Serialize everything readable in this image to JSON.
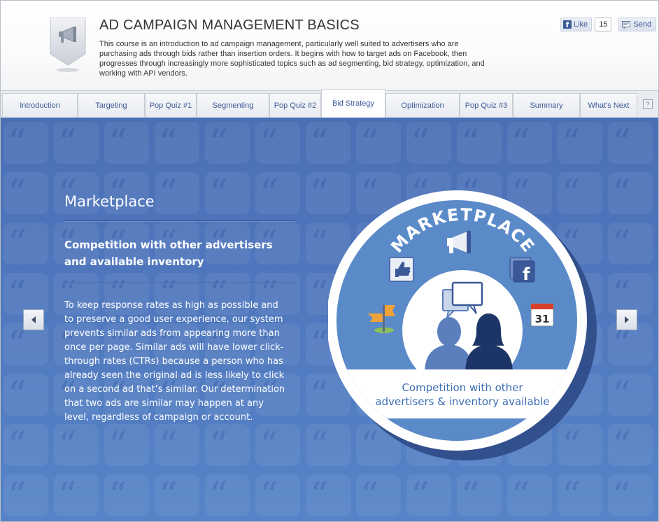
{
  "header": {
    "title": "AD CAMPAIGN MANAGEMENT BASICS",
    "description": "This course is an introduction to ad campaign management, particularly well suited to advertisers who are purchasing ads through bids rather than insertion orders. It begins with how to target ads on Facebook, then progresses through increasingly more sophisticated topics such as ad segmenting, bid strategy, optimization, and working with API vendors.",
    "badge_icon": "megaphone-icon"
  },
  "social": {
    "like_label": "Like",
    "like_count": "15",
    "send_label": "Send"
  },
  "tabs": [
    {
      "label": "Introduction",
      "active": false
    },
    {
      "label": "Targeting",
      "active": false
    },
    {
      "label": "Pop Quiz #1",
      "active": false
    },
    {
      "label": "Segmenting",
      "active": false
    },
    {
      "label": "Pop Quiz #2",
      "active": false
    },
    {
      "label": "Bid Strategy",
      "active": true
    },
    {
      "label": "Optimization",
      "active": false
    },
    {
      "label": "Pop Quiz #3",
      "active": false
    },
    {
      "label": "Summary",
      "active": false
    },
    {
      "label": "What's Next",
      "active": false
    }
  ],
  "help_label": "?",
  "slide": {
    "title": "Marketplace",
    "subtitle": "Competition with other advertisers and available inventory",
    "body": "To keep response rates as high as possible and to preserve a good user experience, our system prevents similar ads from appearing more than once per page. Similar ads will have lower click-through rates (CTRs) because a person who has already seen the original ad is less likely to click on a second ad that’s similar. Our determination that two ads are similar may happen at any level, regardless of campaign or account."
  },
  "graphic": {
    "arc_text": "MARKETPLACE",
    "calendar_day": "31",
    "caption_line1": "Competition with other",
    "caption_line2": "advertisers & inventory available"
  },
  "colors": {
    "brand": "#3b5998",
    "stage": "#4f77bd",
    "circle": "#5b8ac9",
    "caption": "#3b6db5"
  }
}
